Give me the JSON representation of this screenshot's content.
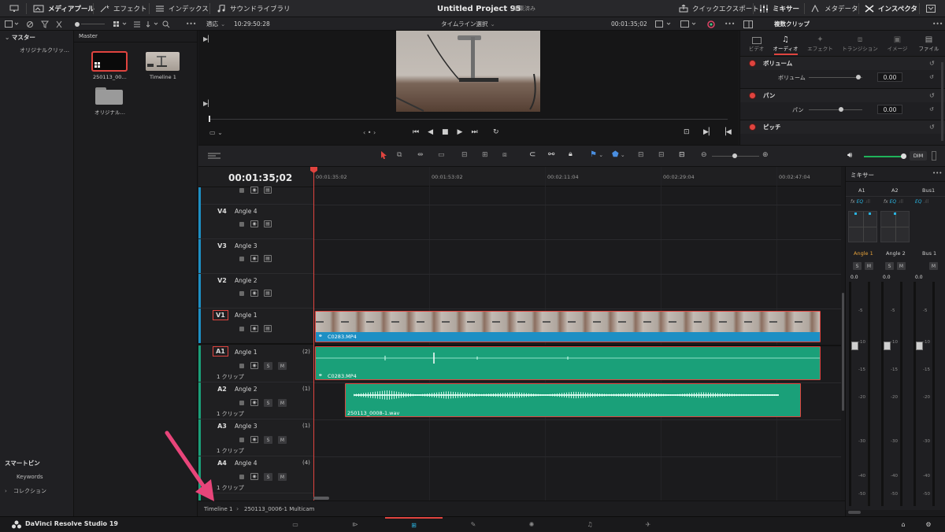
{
  "topbar": {
    "media_pool": "メディアプール",
    "effects": "エフェクト",
    "index": "インデックス",
    "sound_library": "サウンドライブラリ",
    "project_title": "Untitled Project 95",
    "edit_status": "編集済み",
    "quick_export": "クイックエクスポート",
    "mixer": "ミキサー",
    "metadata": "メタデータ",
    "inspector": "インスペクタ"
  },
  "toolbar2": {
    "fit": "適応",
    "source_timecode": "10:29:50:28",
    "timeline_select": "タイムライン選択",
    "viewer_timecode": "00:01:35;02",
    "inspector_title": "複数クリップ"
  },
  "sidebar": {
    "master": "マスター",
    "original_clips": "オリジナルクリッ…",
    "smart_bins": "スマートビン",
    "keywords": "Keywords",
    "collections": "コレクション"
  },
  "bin": {
    "title": "Master",
    "items": [
      {
        "label": "250113_00…",
        "selected": true
      },
      {
        "label": "Timeline 1",
        "selected": false
      },
      {
        "label": "オリジナル…",
        "selected": false
      }
    ]
  },
  "inspector": {
    "tabs": [
      "ビデオ",
      "オーディオ",
      "エフェクト",
      "トランジション",
      "イメージ",
      "ファイル"
    ],
    "active_tab": "オーディオ",
    "sections": [
      {
        "title": "ボリューム",
        "param": "ボリューム",
        "value": "0.00"
      },
      {
        "title": "パン",
        "param": "パン",
        "value": "0.00"
      },
      {
        "title": "ピッチ"
      }
    ]
  },
  "timeline": {
    "timecode": "00:01:35;02",
    "ruler": [
      "00:01:35:02",
      "00:01:53:02",
      "00:02:11:04",
      "00:02:29:04",
      "00:02:47:04"
    ],
    "video_tracks": [
      {
        "id": "V4",
        "name": "Angle 4"
      },
      {
        "id": "V3",
        "name": "Angle 3"
      },
      {
        "id": "V2",
        "name": "Angle 2"
      },
      {
        "id": "V1",
        "name": "Angle 1"
      }
    ],
    "audio_tracks": [
      {
        "id": "A1",
        "name": "Angle 1",
        "channels": "(2)",
        "clips": "1 クリップ"
      },
      {
        "id": "A2",
        "name": "Angle 2",
        "channels": "(1)",
        "clips": "1 クリップ"
      },
      {
        "id": "A3",
        "name": "Angle 3",
        "channels": "(1)",
        "clips": "1 クリップ"
      },
      {
        "id": "A4",
        "name": "Angle 4",
        "channels": "(4)",
        "clips": "1 クリップ"
      }
    ],
    "clips": {
      "video_v1": "C0283.MP4",
      "audio_a1": "C0283.MP4",
      "audio_a2": "250113_0008-1.wav"
    },
    "track_buttons": {
      "solo": "S",
      "mute": "M"
    }
  },
  "mixer": {
    "title": "ミキサー",
    "channels": [
      "A1",
      "A2",
      "Bus1"
    ],
    "names": [
      "Angle 1",
      "Angle 2",
      "Bus 1"
    ],
    "fx": "fx",
    "eq": "EQ",
    "levels": [
      "0.0",
      "0.0",
      "0.0"
    ],
    "scale": [
      "-5",
      "-10",
      "-15",
      "-20",
      "-30",
      "-40",
      "-50"
    ],
    "dim": "DIM"
  },
  "statusbar": {
    "breadcrumb": [
      "Timeline 1",
      "250113_0006-1 Multicam"
    ]
  },
  "bottombar": {
    "app_name": "DaVinci Resolve Studio 19"
  },
  "colors": {
    "accent_red": "#e0443f",
    "video_clip_blue": "#1d8fc4",
    "audio_clip_green": "#1aa079",
    "annotation_arrow": "#e8457a"
  }
}
